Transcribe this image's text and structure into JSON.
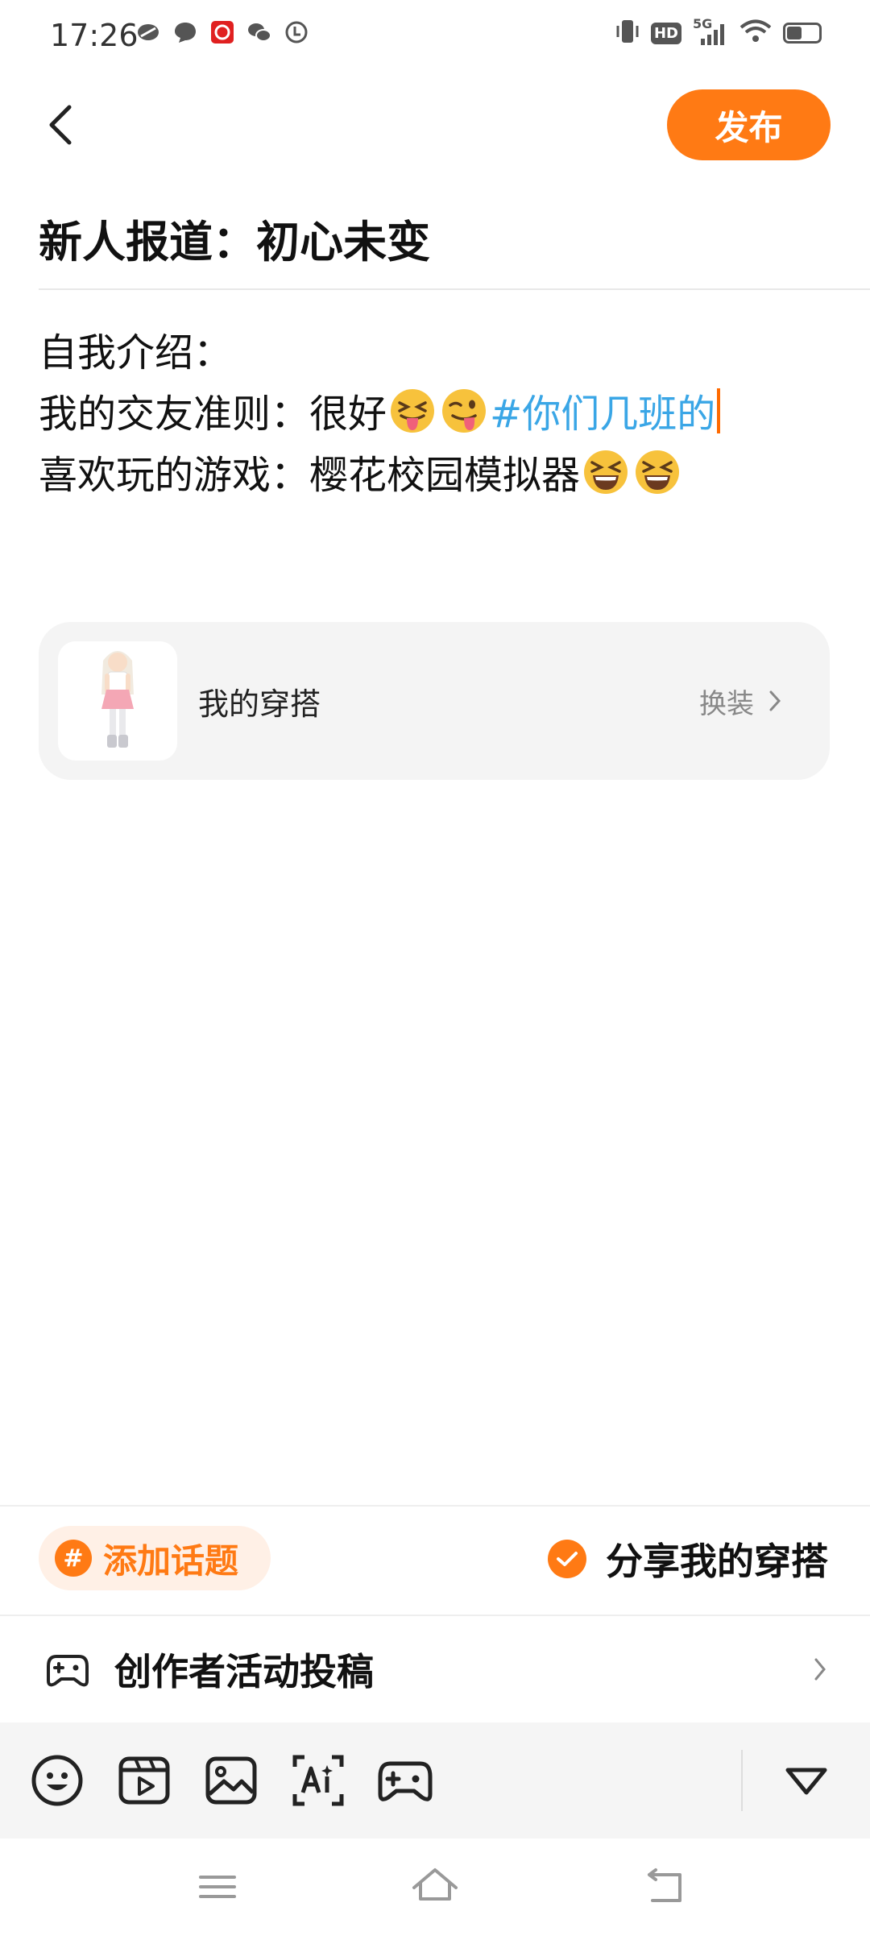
{
  "status_bar": {
    "time": "17:26",
    "network_badge": "HD",
    "signal_label": "5G"
  },
  "header": {
    "publish_label": "发布"
  },
  "post": {
    "title": "新人报道：初心未变",
    "lines": [
      {
        "text": "自我介绍："
      },
      {
        "text": "我的交友准则：很好",
        "emojis": [
          "squinting-tongue-face",
          "winking-tongue-face"
        ],
        "hashtag": "#你们几班的"
      },
      {
        "text": "喜欢玩的游戏：樱花校园模拟器",
        "emojis": [
          "grinning-squinting-face",
          "grinning-squinting-face"
        ]
      }
    ]
  },
  "outfit_card": {
    "label": "我的穿搭",
    "action_label": "换装"
  },
  "bottom": {
    "add_topic_label": "添加话题",
    "share_outfit_label": "分享我的穿搭",
    "share_outfit_checked": true,
    "creator_activity_label": "创作者活动投稿"
  },
  "toolbar": {
    "icons": [
      "emoji-icon",
      "video-icon",
      "image-icon",
      "ai-text-icon",
      "game-icon",
      "collapse-icon"
    ]
  },
  "theme": {
    "accent": "#ff7a14",
    "hashtag": "#3aa6e6"
  }
}
